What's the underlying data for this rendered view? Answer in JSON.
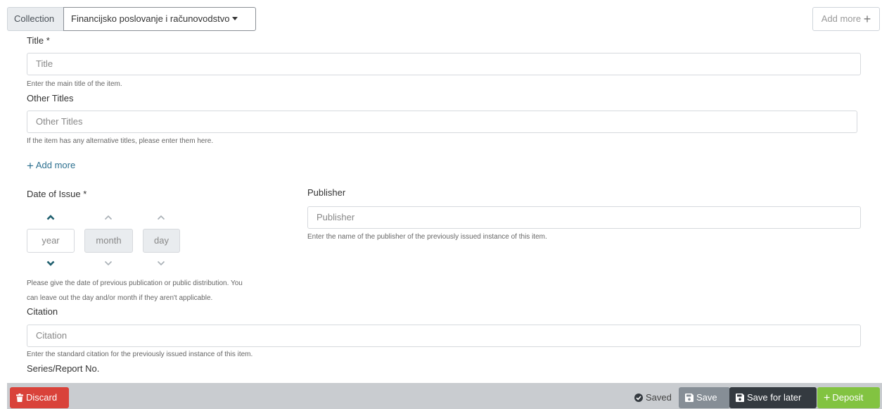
{
  "header": {
    "collection_label": "Collection",
    "collection_value": "Financijsko poslovanje i računovodstvo",
    "add_more_label": "Add more"
  },
  "form": {
    "title": {
      "label": "Title *",
      "placeholder": "Title",
      "hint": "Enter the main title of the item."
    },
    "other_titles": {
      "label": "Other Titles",
      "placeholder": "Other Titles",
      "hint": "If the item has any alternative titles, please enter them here.",
      "add_more": "Add more"
    },
    "date_of_issue": {
      "label": "Date of Issue *",
      "year": "year",
      "month": "month",
      "day": "day",
      "hint_line1": "Please give the date of previous publication or public distribution. You",
      "hint_line2": "can leave out the day and/or month if they aren't applicable."
    },
    "publisher": {
      "label": "Publisher",
      "placeholder": "Publisher",
      "hint": "Enter the name of the publisher of the previously issued instance of this item."
    },
    "citation": {
      "label": "Citation",
      "placeholder": "Citation",
      "hint": "Enter the standard citation for the previously issued instance of this item."
    },
    "series": {
      "label": "Series/Report No."
    }
  },
  "footer": {
    "discard": "Discard",
    "saved": "Saved",
    "save": "Save",
    "save_for_later": "Save for later",
    "deposit": "Deposit"
  },
  "colors": {
    "discard": "#d9423a",
    "save": "#868e96",
    "save_for_later": "#343a40",
    "deposit": "#82c341",
    "link": "#2b6f8f",
    "chevron_active": "#1f5f6e",
    "chevron_inactive": "#a9b0b6"
  },
  "icons": [
    "plus-icon",
    "chevron-up-icon",
    "chevron-down-icon",
    "trash-icon",
    "check-circle-icon",
    "floppy-disk-icon"
  ]
}
